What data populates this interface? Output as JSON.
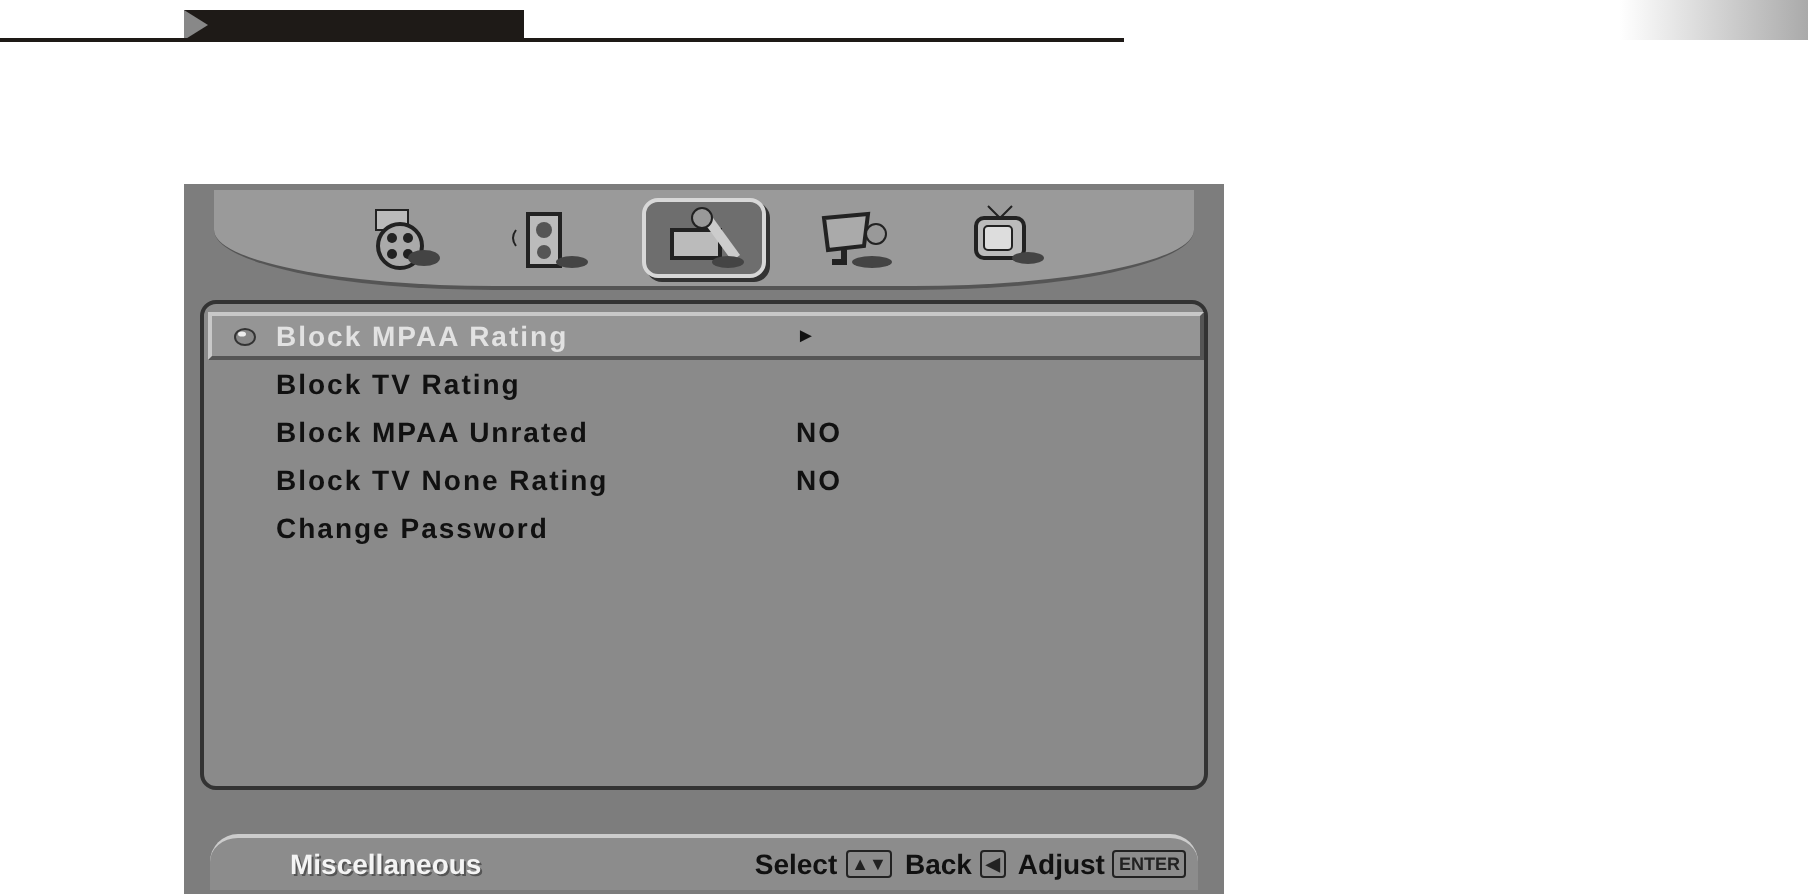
{
  "tabs": [
    {
      "kind": "film",
      "selected": false
    },
    {
      "kind": "speaker",
      "selected": false
    },
    {
      "kind": "tools",
      "selected": true
    },
    {
      "kind": "monitor",
      "selected": false
    },
    {
      "kind": "tv",
      "selected": false
    }
  ],
  "menu": [
    {
      "label": "Block MPAA Rating",
      "value": "►",
      "selected": true
    },
    {
      "label": "Block TV Rating",
      "selected": false
    },
    {
      "label": "Block MPAA Unrated",
      "value": "NO",
      "selected": false
    },
    {
      "label": "Block TV None Rating",
      "value": "NO",
      "selected": false
    },
    {
      "label": "Change Password",
      "selected": false
    }
  ],
  "footer": {
    "section": "Miscellaneous",
    "hints": [
      {
        "label": "Select",
        "key": "▲▼"
      },
      {
        "label": "Back",
        "key": "◀"
      },
      {
        "label": "Adjust",
        "key": "ENTER"
      }
    ]
  }
}
